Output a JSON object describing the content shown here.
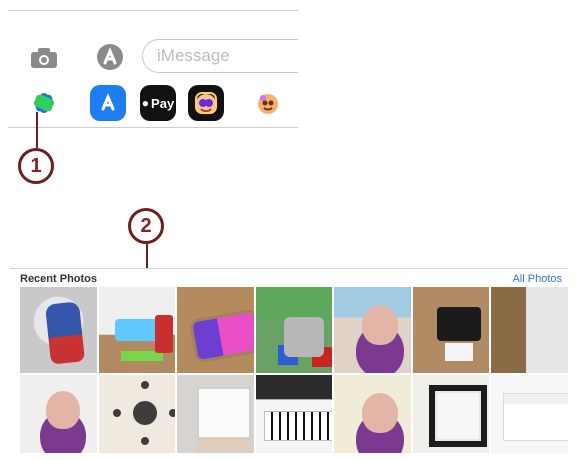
{
  "messages": {
    "input": {
      "placeholder": "iMessage"
    },
    "apps": {
      "apple_pay_label": "Pay"
    }
  },
  "callouts": {
    "first": "1",
    "second": "2"
  },
  "photos": {
    "title": "Recent Photos",
    "all_link": "All Photos"
  },
  "colors": {
    "callout": "#6f1f1f",
    "link": "#2f78d0",
    "appstore_blue": "#1f7df2"
  }
}
